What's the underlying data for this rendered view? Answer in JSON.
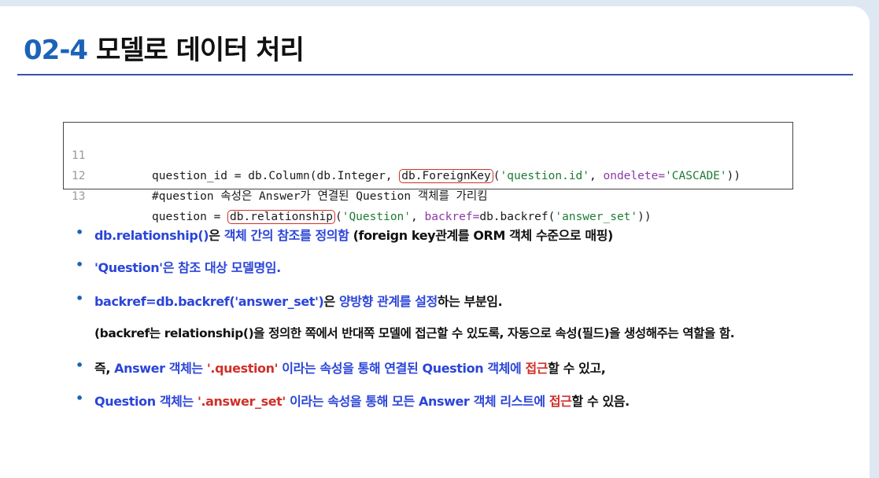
{
  "title": {
    "number": "02-4",
    "text": "모델로 데이터 처리"
  },
  "code": {
    "lines": [
      {
        "num": "11",
        "seg": [
          "question_id = db.Column(db.Integer, ",
          "db.ForeignKey",
          "(",
          "'question.id'",
          ", ",
          "ondelete=",
          "'CASCADE'",
          "))"
        ]
      },
      {
        "num": "12",
        "comment": "#question 속성은 Answer가 연결된 Question 객체를 가리킴"
      },
      {
        "num": "13",
        "seg": [
          "question = ",
          "db.relationship",
          "(",
          "'Question'",
          ", ",
          "backref=",
          "db.backref(",
          "'answer_set'",
          "))"
        ]
      }
    ]
  },
  "bullets": {
    "b1": [
      "db.relationship()",
      "은 ",
      "객체 간의 참조를 정의함",
      " (foreign key관계를 ORM 객체 수준으로 매핑)"
    ],
    "b2": [
      "'Question'",
      "은 참조 대상 모델명임."
    ],
    "b3": [
      "backref=db.backref('answer_set')",
      "은 ",
      "양방향 관계를 설정",
      "하는 부분임."
    ],
    "b3_sub": "(backref는 relationship()을 정의한 쪽에서 반대쪽 모델에 접근할 수 있도록, 자동으로 속성(필드)을 생성해주는 역할을 함.",
    "b4": [
      "즉, ",
      "Answer 객체는 ",
      "'.question'",
      " 이라는 속성을 통해 연결된 Question 객체에 ",
      "접근",
      "할 수 있고,"
    ],
    "b5": [
      "Question 객체는 ",
      "'.answer_set'",
      " 이라는 속성을 통해 모든 Answer 객체 리스트에 ",
      "접근",
      "할 수 있음."
    ],
    "bullet_char": "•"
  }
}
